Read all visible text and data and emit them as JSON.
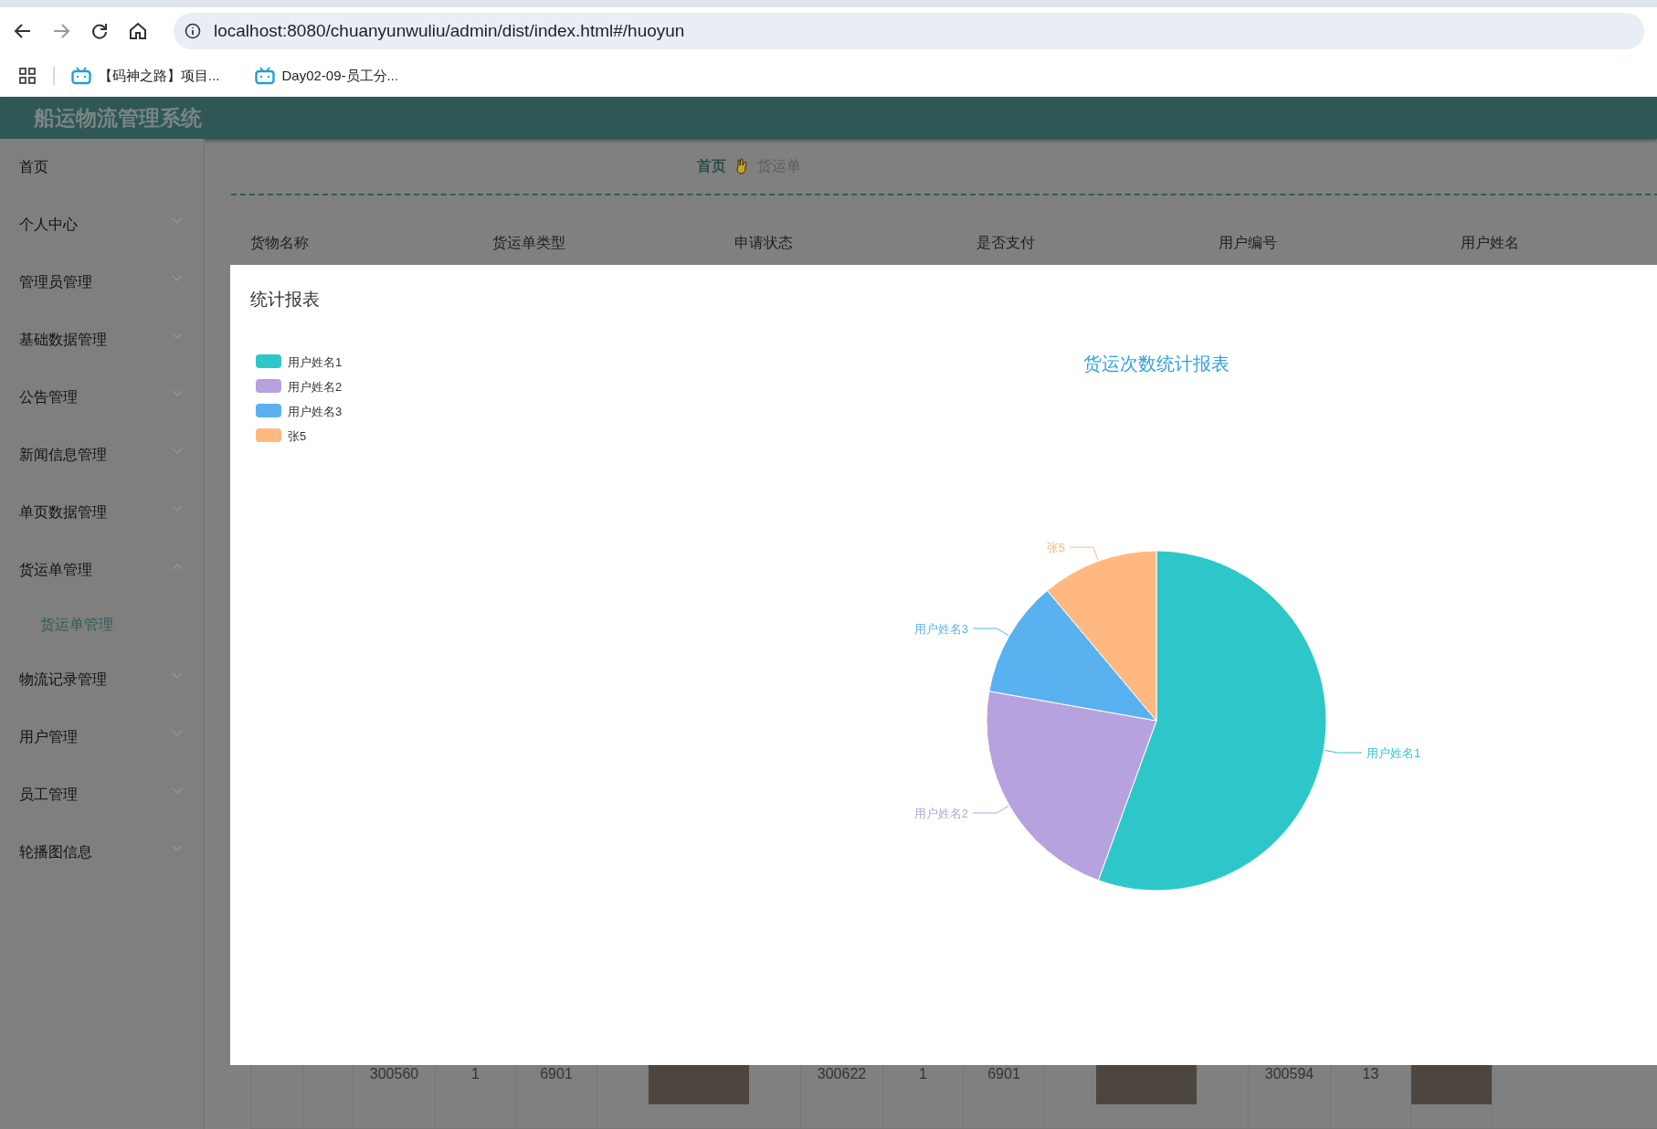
{
  "browser": {
    "url": "localhost:8080/chuanyunwuliu/admin/dist/index.html#/huoyun",
    "bookmarks": [
      "【码神之路】项目...",
      "Day02-09-员工分..."
    ]
  },
  "app": {
    "title": "船运物流管理系统"
  },
  "sidebar": {
    "items": [
      {
        "label": "首页",
        "kind": "link"
      },
      {
        "label": "个人中心",
        "kind": "menu",
        "expanded": false
      },
      {
        "label": "管理员管理",
        "kind": "menu",
        "expanded": false
      },
      {
        "label": "基础数据管理",
        "kind": "menu",
        "expanded": false
      },
      {
        "label": "公告管理",
        "kind": "menu",
        "expanded": false
      },
      {
        "label": "新闻信息管理",
        "kind": "menu",
        "expanded": false
      },
      {
        "label": "单页数据管理",
        "kind": "menu",
        "expanded": false
      },
      {
        "label": "货运单管理",
        "kind": "menu",
        "expanded": true,
        "children": [
          {
            "label": "货运单管理",
            "selected": true
          }
        ]
      },
      {
        "label": "物流记录管理",
        "kind": "menu",
        "expanded": false
      },
      {
        "label": "用户管理",
        "kind": "menu",
        "expanded": false
      },
      {
        "label": "员工管理",
        "kind": "menu",
        "expanded": false
      },
      {
        "label": "轮播图信息",
        "kind": "menu",
        "expanded": false
      }
    ]
  },
  "breadcrumb": [
    "首页",
    "货运单"
  ],
  "table": {
    "columns": [
      "货物名称",
      "货运单类型",
      "申请状态",
      "是否支付",
      "用户编号",
      "用户姓名"
    ],
    "lower_rows": [
      {
        "cells": [
          {
            "kind": "blank"
          },
          {
            "kind": "blank"
          },
          {
            "kind": "text",
            "text": "300560"
          },
          {
            "kind": "text",
            "text": "1"
          },
          {
            "kind": "text",
            "text": "6901"
          },
          {
            "kind": "photo"
          },
          {
            "kind": "text",
            "text": "300622"
          },
          {
            "kind": "text",
            "text": "1"
          },
          {
            "kind": "text",
            "text": "6901"
          },
          {
            "kind": "photo"
          },
          {
            "kind": "text",
            "text": "300594"
          },
          {
            "kind": "text",
            "text": "13"
          },
          {
            "kind": "photo"
          },
          {
            "kind": "blank"
          }
        ]
      }
    ]
  },
  "dialog": {
    "title": "统计报表",
    "chart_data": {
      "type": "pie",
      "title": "货运次数统计报表",
      "categories": [
        "用户姓名1",
        "用户姓名2",
        "用户姓名3",
        "张5"
      ],
      "colors": [
        "#2ec7c9",
        "#b6a2de",
        "#5ab1ef",
        "#ffb980"
      ],
      "legend": "left",
      "values": [
        5,
        2,
        1,
        1
      ]
    }
  }
}
